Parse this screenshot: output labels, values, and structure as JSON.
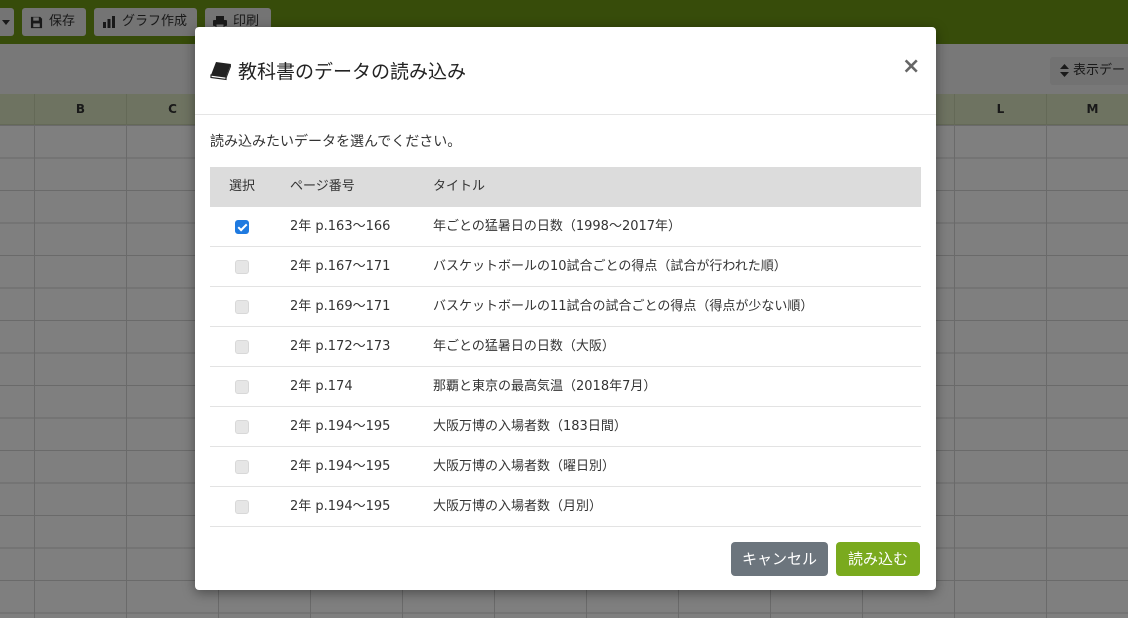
{
  "toolbar": {
    "buttons": [
      {
        "icon": "floppy-icon",
        "label": "保存"
      },
      {
        "icon": "bar-chart-icon",
        "label": "グラフ作成"
      },
      {
        "icon": "printer-icon",
        "label": "印刷"
      }
    ],
    "display_button": {
      "icon": "sort-icon",
      "label": "表示デー"
    }
  },
  "sheet": {
    "columns": [
      "B",
      "C",
      "L",
      "M"
    ]
  },
  "modal": {
    "title": "教科書のデータの読み込み",
    "title_icon": "book-icon",
    "close": "×",
    "instruction": "読み込みたいデータを選んでください。",
    "headers": {
      "select": "選択",
      "page": "ページ番号",
      "title": "タイトル"
    },
    "rows": [
      {
        "checked": true,
        "page": "2年 p.163〜166",
        "title": "年ごとの猛暑日の日数（1998〜2017年）"
      },
      {
        "checked": false,
        "page": "2年 p.167〜171",
        "title": "バスケットボールの10試合ごとの得点（試合が行われた順）"
      },
      {
        "checked": false,
        "page": "2年 p.169〜171",
        "title": "バスケットボールの11試合の試合ごとの得点（得点が少ない順）"
      },
      {
        "checked": false,
        "page": "2年 p.172〜173",
        "title": "年ごとの猛暑日の日数（大阪）"
      },
      {
        "checked": false,
        "page": "2年 p.174",
        "title": "那覇と東京の最高気温（2018年7月）"
      },
      {
        "checked": false,
        "page": "2年 p.194〜195",
        "title": "大阪万博の入場者数（183日間）"
      },
      {
        "checked": false,
        "page": "2年 p.194〜195",
        "title": "大阪万博の入場者数（曜日別）"
      },
      {
        "checked": false,
        "page": "2年 p.194〜195",
        "title": "大阪万博の入場者数（月別）"
      }
    ],
    "cancel_label": "キャンセル",
    "load_label": "読み込む"
  },
  "colors": {
    "toolbar": "#6f9814",
    "primary_check": "#1f7ae0",
    "load_button": "#7aaa1e",
    "cancel_button": "#6c757d"
  }
}
